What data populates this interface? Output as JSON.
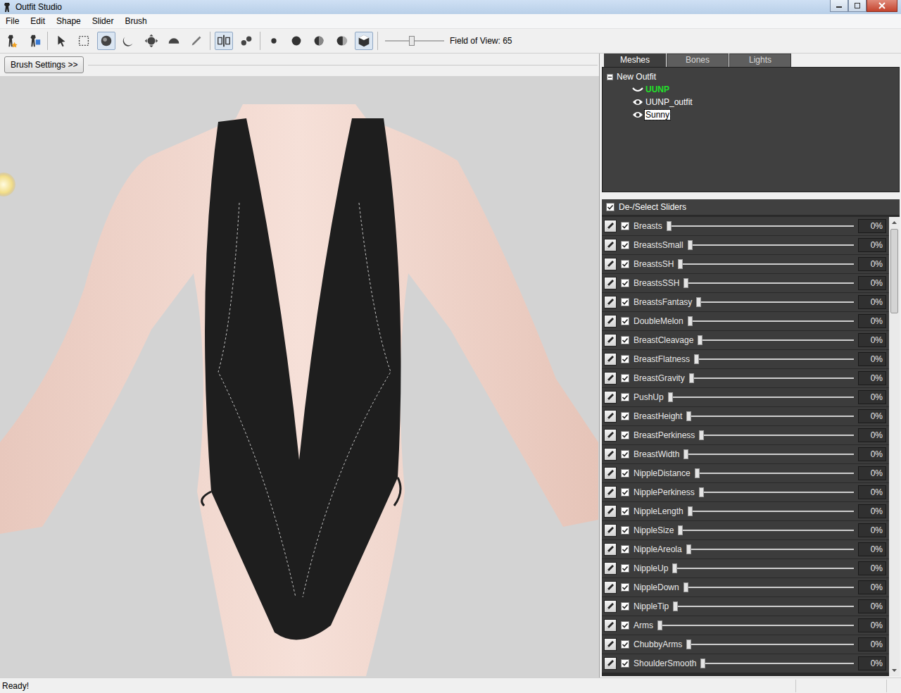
{
  "window": {
    "title": "Outfit Studio"
  },
  "menu": [
    "File",
    "Edit",
    "Shape",
    "Slider",
    "Brush"
  ],
  "toolbar": {
    "groups": [
      [
        {
          "pressed": false
        },
        {
          "pressed": false
        }
      ],
      [
        {
          "pressed": false
        },
        {
          "pressed": false
        },
        {
          "pressed": true
        },
        {
          "pressed": false
        },
        {
          "pressed": false
        },
        {
          "pressed": false
        },
        {
          "pressed": false
        }
      ],
      [
        {
          "pressed": true
        },
        {
          "pressed": false
        }
      ],
      [
        {
          "pressed": false
        },
        {
          "pressed": false
        },
        {
          "pressed": false
        },
        {
          "pressed": false
        },
        {
          "pressed": true
        }
      ]
    ],
    "fov": {
      "level": 0.45,
      "label": "Field of View: 65"
    }
  },
  "brush_settings": {
    "label": "Brush Settings >>"
  },
  "tabs": [
    {
      "label": "Meshes",
      "selected": true
    },
    {
      "label": "Bones",
      "selected": false
    },
    {
      "label": "Lights",
      "selected": false
    }
  ],
  "tree": {
    "label": "New Outfit",
    "expanded": true,
    "children": [
      {
        "label": "UUNP",
        "kind": "reference",
        "selected": false
      },
      {
        "label": "UUNP_outfit",
        "kind": "visible",
        "selected": false
      },
      {
        "label": "Sunny",
        "kind": "visible",
        "selected": true
      }
    ]
  },
  "sliders_header": {
    "label": "De-/Select Sliders",
    "checked": true
  },
  "sliders": [
    {
      "name": "Breasts",
      "checked": true,
      "level": 0,
      "value": "0%"
    },
    {
      "name": "BreastsSmall",
      "checked": true,
      "level": 0,
      "value": "0%"
    },
    {
      "name": "BreastsSH",
      "checked": true,
      "level": 0,
      "value": "0%"
    },
    {
      "name": "BreastsSSH",
      "checked": true,
      "level": 0,
      "value": "0%"
    },
    {
      "name": "BreastsFantasy",
      "checked": true,
      "level": 0,
      "value": "0%"
    },
    {
      "name": "DoubleMelon",
      "checked": true,
      "level": 0,
      "value": "0%"
    },
    {
      "name": "BreastCleavage",
      "checked": true,
      "level": 0,
      "value": "0%"
    },
    {
      "name": "BreastFlatness",
      "checked": true,
      "level": 0,
      "value": "0%"
    },
    {
      "name": "BreastGravity",
      "checked": true,
      "level": 0,
      "value": "0%"
    },
    {
      "name": "PushUp",
      "checked": true,
      "level": 0,
      "value": "0%"
    },
    {
      "name": "BreastHeight",
      "checked": true,
      "level": 0,
      "value": "0%"
    },
    {
      "name": "BreastPerkiness",
      "checked": true,
      "level": 0,
      "value": "0%"
    },
    {
      "name": "BreastWidth",
      "checked": true,
      "level": 0,
      "value": "0%"
    },
    {
      "name": "NippleDistance",
      "checked": true,
      "level": 0,
      "value": "0%"
    },
    {
      "name": "NipplePerkiness",
      "checked": true,
      "level": 0,
      "value": "0%"
    },
    {
      "name": "NippleLength",
      "checked": true,
      "level": 0,
      "value": "0%"
    },
    {
      "name": "NippleSize",
      "checked": true,
      "level": 0,
      "value": "0%"
    },
    {
      "name": "NippleAreola",
      "checked": true,
      "level": 0,
      "value": "0%"
    },
    {
      "name": "NippleUp",
      "checked": true,
      "level": 0,
      "value": "0%"
    },
    {
      "name": "NippleDown",
      "checked": true,
      "level": 0,
      "value": "0%"
    },
    {
      "name": "NippleTip",
      "checked": true,
      "level": 0,
      "value": "0%"
    },
    {
      "name": "Arms",
      "checked": true,
      "level": 0,
      "value": "0%"
    },
    {
      "name": "ChubbyArms",
      "checked": true,
      "level": 0,
      "value": "0%"
    },
    {
      "name": "ShoulderSmooth",
      "checked": true,
      "level": 0,
      "value": "0%"
    }
  ],
  "status_bar": {
    "text": "Ready!"
  }
}
